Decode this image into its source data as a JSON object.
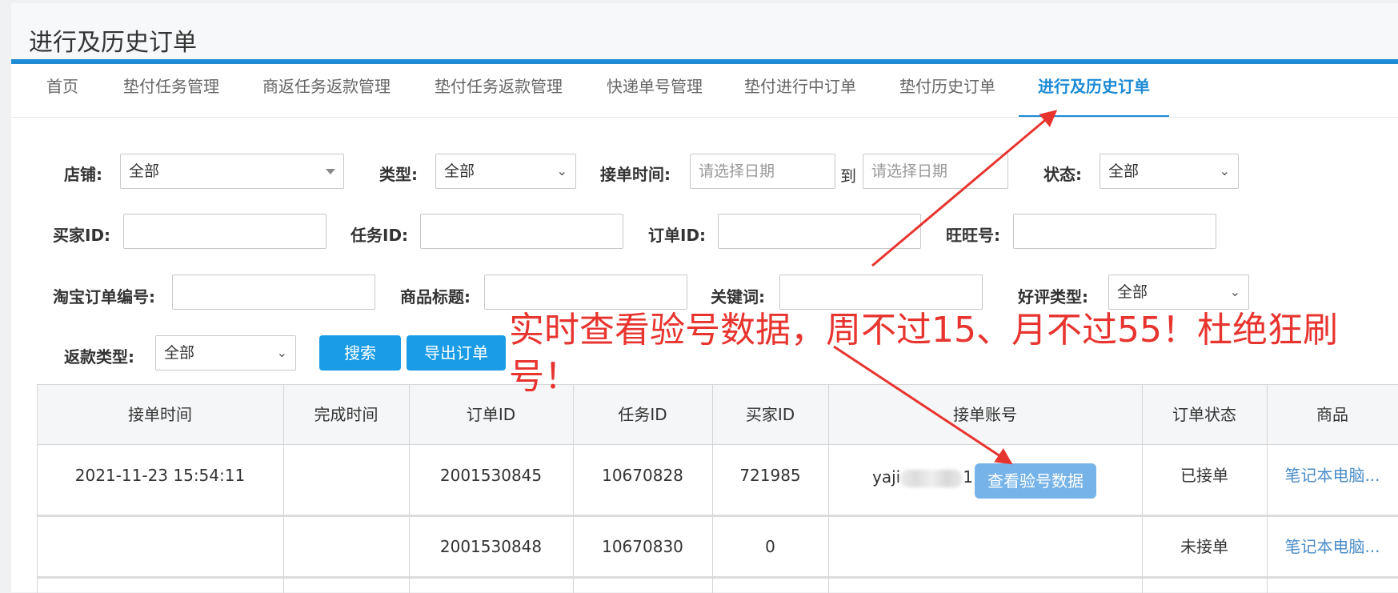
{
  "page_title": "进行及历史订单",
  "tabs": [
    "首页",
    "垫付任务管理",
    "商返任务返款管理",
    "垫付任务返款管理",
    "快递单号管理",
    "垫付进行中订单",
    "垫付历史订单",
    "进行及历史订单"
  ],
  "active_tab": "进行及历史订单",
  "filters": {
    "shop": {
      "label": "店铺:",
      "value": "全部"
    },
    "type": {
      "label": "类型:",
      "value": "全部"
    },
    "accept_time": {
      "label": "接单时间:",
      "start_placeholder": "请选择日期",
      "to": "到",
      "end_placeholder": "请选择日期"
    },
    "status": {
      "label": "状态:",
      "value": "全部"
    },
    "buyer_id": {
      "label": "买家ID:",
      "value": ""
    },
    "task_id": {
      "label": "任务ID:",
      "value": ""
    },
    "order_id": {
      "label": "订单ID:",
      "value": ""
    },
    "wangwang": {
      "label": "旺旺号:",
      "value": ""
    },
    "taobao_order": {
      "label": "淘宝订单编号:",
      "value": ""
    },
    "product_title": {
      "label": "商品标题:",
      "value": ""
    },
    "keyword": {
      "label": "关键词:",
      "value": ""
    },
    "review_type": {
      "label": "好评类型:",
      "value": "全部"
    },
    "refund_type": {
      "label": "返款类型:",
      "value": "全部"
    }
  },
  "buttons": {
    "search": "搜索",
    "export": "导出订单"
  },
  "table": {
    "headers": [
      "接单时间",
      "完成时间",
      "订单ID",
      "任务ID",
      "买家ID",
      "接单账号",
      "订单状态",
      "商品"
    ],
    "rows": [
      {
        "accept_time": "2021-11-23 15:54:11",
        "finish_time": "",
        "order_id": "2001530845",
        "task_id": "10670828",
        "buyer_id": "721985",
        "account_prefix": "yaji",
        "account_suffix": "1",
        "account_button": "查看验号数据",
        "status": "已接单",
        "product": "笔记本电脑..."
      },
      {
        "accept_time": "",
        "finish_time": "",
        "order_id": "2001530848",
        "task_id": "10670830",
        "buyer_id": "0",
        "account_prefix": "",
        "account_suffix": "",
        "account_button": "",
        "status": "未接单",
        "product": "笔记本电脑..."
      }
    ]
  },
  "annotation": {
    "text": "实时查看验号数据，周不过15、月不过55！杜绝狂刷号！",
    "color": "#e8342f"
  },
  "colors": {
    "accent": "#1e8bd6",
    "button": "#1a9ce6",
    "link": "#4a8cc7"
  }
}
